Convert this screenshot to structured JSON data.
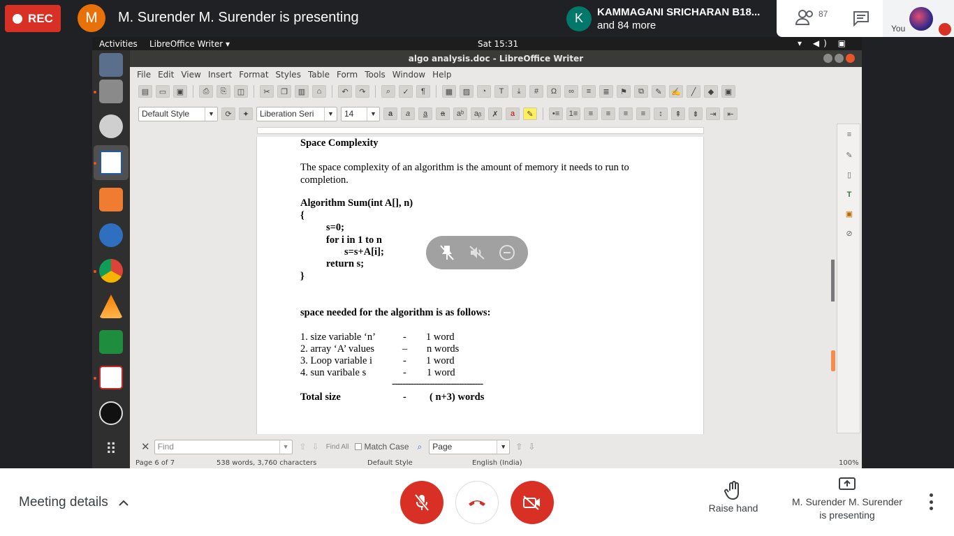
{
  "meet": {
    "rec_label": "REC",
    "presenter_initial": "M",
    "presenting_title": "M. Surender M. Surender is presenting",
    "participant_initial": "K",
    "participant_name": "KAMMAGANI SRICHARAN B18...",
    "participant_more": "and 84 more",
    "people_count": "87",
    "you_label": "You",
    "meeting_details": "Meeting details",
    "raise_hand": "Raise hand",
    "presenting_line1": "M. Surender M. Surender",
    "presenting_line2": "is presenting"
  },
  "ubuntu": {
    "activities": "Activities",
    "app_menu": "LibreOffice Writer ▾",
    "clock": "Sat 15:31",
    "tray": "▾ ◀) ▣ ▾"
  },
  "writer": {
    "window_title": "algo analysis.doc - LibreOffice Writer",
    "menu": [
      "File",
      "Edit",
      "View",
      "Insert",
      "Format",
      "Styles",
      "Table",
      "Form",
      "Tools",
      "Window",
      "Help"
    ],
    "para_style": "Default Style",
    "font_name": "Liberation Seri",
    "font_size": "14",
    "find_placeholder": "Find",
    "find_all": "Find All",
    "match_case": "Match Case",
    "search_scope": "Page",
    "status": {
      "page": "Page 6 of 7",
      "words": "538 words, 3,760 characters",
      "style": "Default Style",
      "language": "English (India)",
      "zoom": "100%"
    }
  },
  "document": {
    "heading": "Space Complexity",
    "para_line1": "The space complexity of an algorithm is the amount of memory it needs to run to",
    "para_line2": "completion.",
    "algo_title": "Algorithm Sum(int A[], n)",
    "open_brace": "{",
    "line_s0": "s=0;",
    "line_for": "for i in 1 to n",
    "line_sum": "s=s+A[i];",
    "line_return": "return s;",
    "close_brace": "}",
    "space_needed": "space needed for the algorithm is as follows:",
    "rows": [
      {
        "label": "1. size variable ‘n’",
        "sep": "-",
        "value": "1 word"
      },
      {
        "label": "2. array ‘A’ values",
        "sep": "–",
        "value": "n words"
      },
      {
        "label": "3. Loop variable i",
        "sep": "-",
        "value": "1 word"
      },
      {
        "label": "4. sun varibale s",
        "sep": "-",
        "value": "1 word"
      }
    ],
    "dashes": "----------------------------------",
    "total_label": "Total size",
    "total_sep": "-",
    "total_value": "( n+3) words"
  }
}
